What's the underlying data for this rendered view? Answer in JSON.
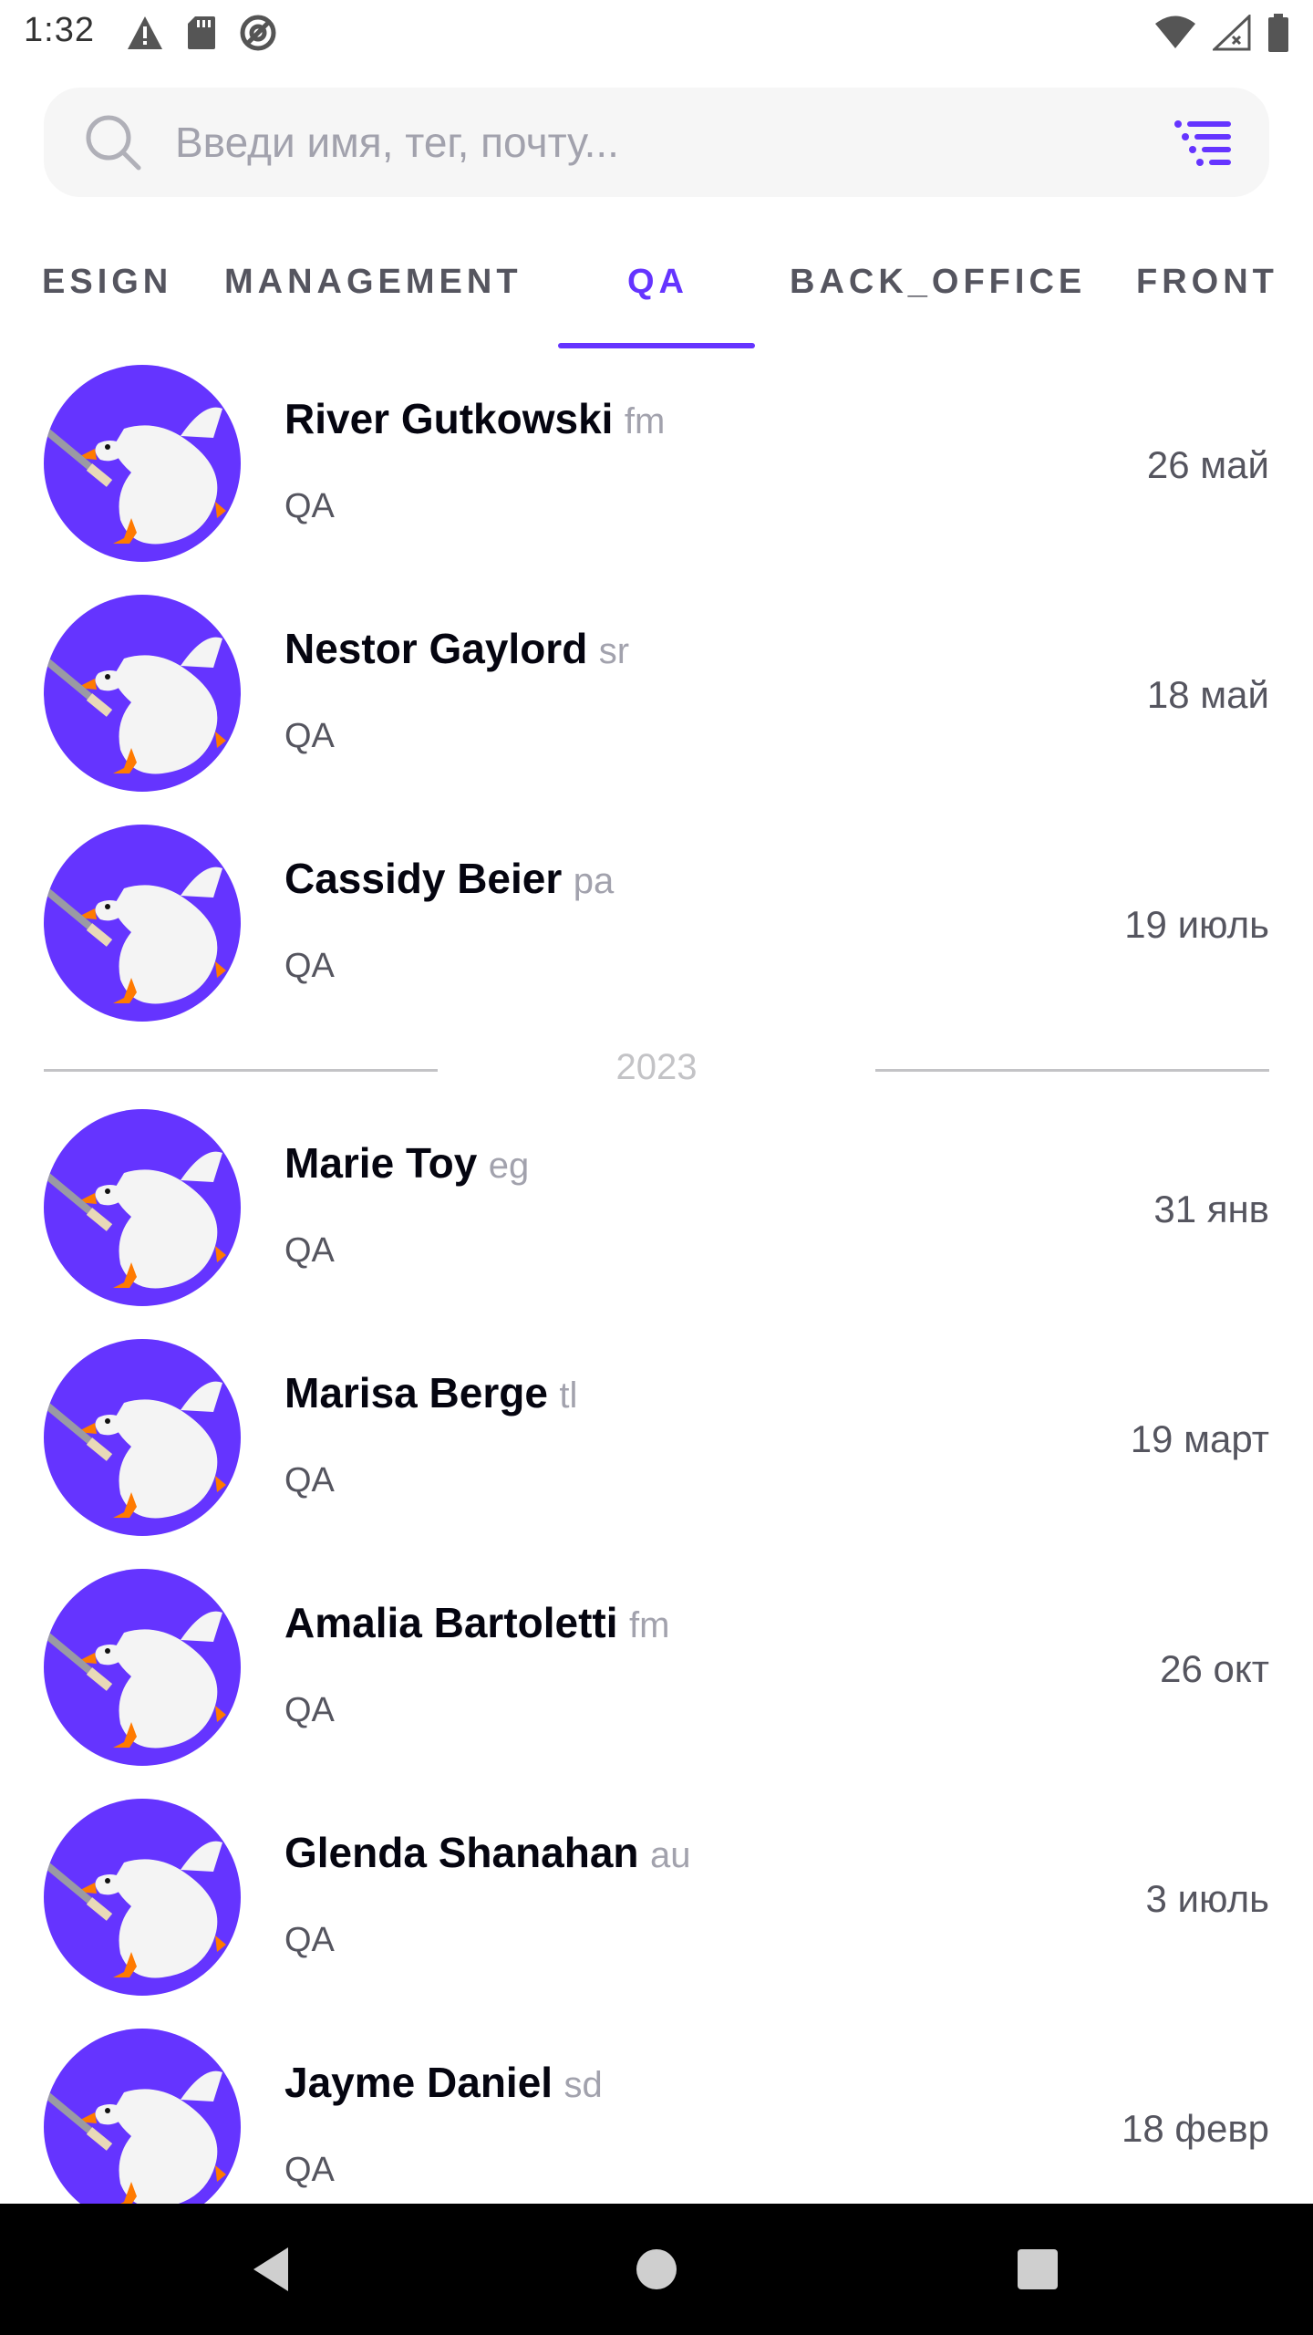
{
  "status_bar": {
    "time": "1:32",
    "left_icons": [
      "warning-icon",
      "sd-card-icon",
      "data-saver-icon"
    ],
    "right_icons": [
      "wifi-icon",
      "signal-no-connection-icon",
      "battery-icon"
    ]
  },
  "search": {
    "placeholder": "Введи имя, тег, почту...",
    "value": ""
  },
  "tabs": [
    {
      "label": "DESIGN",
      "shown_label": "ESIGN",
      "active": false
    },
    {
      "label": "MANAGEMENT",
      "active": false
    },
    {
      "label": "QA",
      "active": true
    },
    {
      "label": "BACK_OFFICE",
      "active": false
    },
    {
      "label": "FRONT",
      "active": false
    }
  ],
  "accent_color": "#6534ff",
  "employees": [
    {
      "name": "River Gutkowski",
      "tag": "fm",
      "department": "QA",
      "birthday": "26 май"
    },
    {
      "name": "Nestor Gaylord",
      "tag": "sr",
      "department": "QA",
      "birthday": "18 май"
    },
    {
      "name": "Cassidy Beier",
      "tag": "pa",
      "department": "QA",
      "birthday": "19 июль"
    },
    {
      "name": "Marie Toy",
      "tag": "eg",
      "department": "QA",
      "birthday": "31 янв"
    },
    {
      "name": "Marisa Berge",
      "tag": "tl",
      "department": "QA",
      "birthday": "19 март"
    },
    {
      "name": "Amalia Bartoletti",
      "tag": "fm",
      "department": "QA",
      "birthday": "26 окт"
    },
    {
      "name": "Glenda Shanahan",
      "tag": "au",
      "department": "QA",
      "birthday": "3 июль"
    },
    {
      "name": "Jayme Daniel",
      "tag": "sd",
      "department": "QA",
      "birthday": "18 февр"
    }
  ],
  "year_divider": "2023",
  "nav": [
    "back-icon",
    "home-icon",
    "recents-icon"
  ]
}
